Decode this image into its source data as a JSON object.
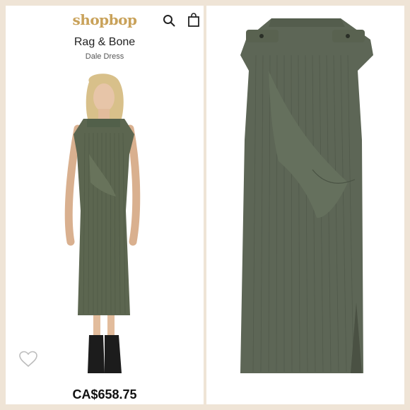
{
  "header": {
    "logo": "shopbop",
    "logo_color": "#c9a25a",
    "icons": [
      "search-icon",
      "shopping-bag-icon"
    ]
  },
  "product": {
    "designer": "Rag & Bone",
    "name": "Dale Dress",
    "price": "CA$658.75"
  },
  "colors": {
    "frame": "#efe4d6",
    "dress": "#5c6650",
    "text": "#111111"
  }
}
